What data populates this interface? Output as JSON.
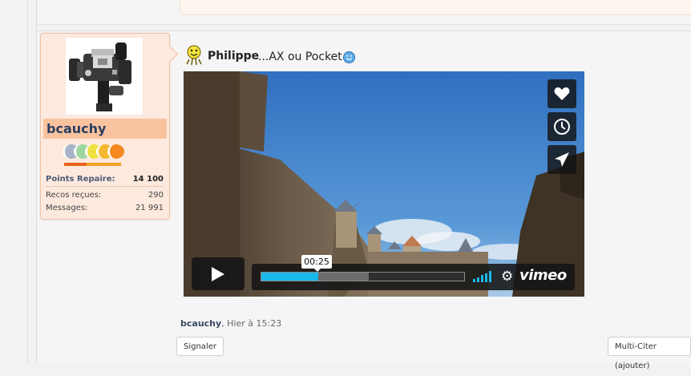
{
  "user": {
    "username": "bcauchy",
    "stats": [
      {
        "label": "Points Repaire:",
        "value": "14 100"
      },
      {
        "label": "Recos reçues:",
        "value": "290"
      },
      {
        "label": "Messages:",
        "value": "21 991"
      }
    ],
    "rank_colors": [
      "#a8b4c8",
      "#9ed6a0",
      "#f0e040",
      "#f5b830",
      "#f58a20"
    ]
  },
  "post": {
    "author": "Philippe",
    "title_rest": "...AX ou Pocket",
    "meta_author": "bcauchy",
    "meta_time": ", Hier à 15:23"
  },
  "video": {
    "time": "00:25",
    "progress": 0.28,
    "buffered": 0.53,
    "brand": "vimeo",
    "accent": "#1ab7ea",
    "side_icons": [
      "heart-icon",
      "clock-icon",
      "send-icon"
    ]
  },
  "actions": {
    "report": "Signaler",
    "multiquote": "Multi-Citer (ajouter)"
  }
}
